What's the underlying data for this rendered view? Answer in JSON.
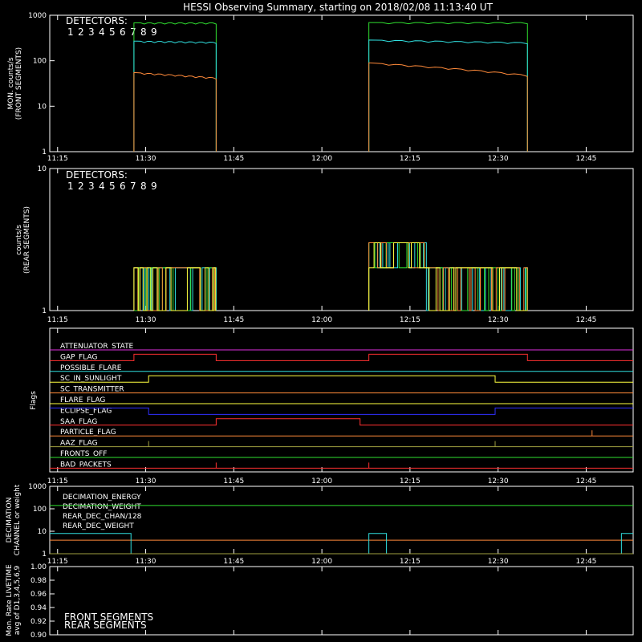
{
  "title": "HESSI Observing Summary, starting on 2018/02/08 11:13:40 UT",
  "x_ticks": [
    "11:15",
    "11:30",
    "11:45",
    "12:00",
    "12:15",
    "12:30",
    "12:45"
  ],
  "detector_colors": [
    "#ff2a2a",
    "#ff5a8a",
    "#ff8a3a",
    "#ffff40",
    "#c8c832",
    "#30e030",
    "#30e0e0",
    "#6a8aff",
    "#3030ff"
  ],
  "chart_data": [
    {
      "type": "line",
      "panel": "front",
      "title": "",
      "detectors_label": "DETECTORS:",
      "detectors": [
        "1",
        "2",
        "3",
        "4",
        "5",
        "6",
        "7",
        "8",
        "9"
      ],
      "ylabel": [
        "MON. counts/s",
        "(FRONT SEGMENTS)"
      ],
      "y_ticks": [
        "1",
        "10",
        "100",
        "1000"
      ],
      "ylim": [
        1,
        1000
      ],
      "yscale": "log",
      "xlim": [
        "11:13:40",
        "12:53:00"
      ],
      "series": [
        {
          "color": "#30e030",
          "values": [
            [
              "11:28:00",
              680
            ],
            [
              "11:42:00",
              680
            ],
            [
              "12:08:00",
              690
            ],
            [
              "12:35:00",
              690
            ]
          ]
        },
        {
          "color": "#30e0e0",
          "values": [
            [
              "11:28:00",
              270
            ],
            [
              "11:42:00",
              255
            ],
            [
              "12:08:00",
              285
            ],
            [
              "12:35:00",
              250
            ]
          ]
        },
        {
          "color": "#ff8a3a",
          "values": [
            [
              "11:28:00",
              55
            ],
            [
              "11:42:00",
              42
            ],
            [
              "12:08:00",
              90
            ],
            [
              "12:35:00",
              48
            ]
          ]
        }
      ]
    },
    {
      "type": "line",
      "panel": "rear",
      "title": "",
      "detectors_label": "DETECTORS:",
      "detectors": [
        "1",
        "2",
        "3",
        "4",
        "5",
        "6",
        "7",
        "8",
        "9"
      ],
      "ylabel": [
        "counts/s",
        "(REAR SEGMENTS)"
      ],
      "y_ticks": [
        "1",
        "10"
      ],
      "ylim": [
        1,
        10
      ],
      "yscale": "log",
      "xlim": [
        "11:13:40",
        "12:53:00"
      ],
      "series_description": "spiky 1-3 counts/s during 11:28-11:42 and 12:08-12:35"
    },
    {
      "type": "line",
      "panel": "flags",
      "ylabel": "Flags",
      "xlim": [
        "11:13:40",
        "12:53:00"
      ],
      "flags": [
        {
          "label": "ATTENUATOR_STATE",
          "color": "#e030e0",
          "segments": [
            [
              "11:13:40",
              "12:53:00",
              0
            ]
          ]
        },
        {
          "label": "GAP_FLAG",
          "color": "#ff3030",
          "segments": [
            [
              "11:13:40",
              "11:28:00",
              0
            ],
            [
              "11:28:00",
              "11:42:00",
              1
            ],
            [
              "11:42:00",
              "12:08:00",
              0
            ],
            [
              "12:08:00",
              "12:35:00",
              1
            ],
            [
              "12:35:00",
              "12:53:00",
              0
            ]
          ]
        },
        {
          "label": "POSSIBLE_FLARE",
          "color": "#30e0e0",
          "segments": [
            [
              "11:13:40",
              "12:53:00",
              0
            ]
          ]
        },
        {
          "label": "SC_IN_SUNLIGHT",
          "color": "#ffff40",
          "segments": [
            [
              "11:13:40",
              "11:30:30",
              0
            ],
            [
              "11:30:30",
              "12:29:30",
              1
            ],
            [
              "12:29:30",
              "12:53:00",
              0
            ]
          ]
        },
        {
          "label": "SC_TRANSMITTER",
          "color": "#ff8a3a",
          "segments": [
            [
              "11:13:40",
              "12:53:00",
              0
            ]
          ]
        },
        {
          "label": "FLARE_FLAG",
          "color": "#ffff40",
          "segments": [
            [
              "11:13:40",
              "12:53:00",
              0
            ]
          ]
        },
        {
          "label": "ECLIPSE_FLAG",
          "color": "#3030ff",
          "segments": [
            [
              "11:13:40",
              "11:30:30",
              1
            ],
            [
              "11:30:30",
              "12:29:30",
              0
            ],
            [
              "12:29:30",
              "12:53:00",
              1
            ]
          ]
        },
        {
          "label": "SAA_FLAG",
          "color": "#ff3030",
          "segments": [
            [
              "11:13:40",
              "11:42:00",
              0
            ],
            [
              "11:42:00",
              "12:06:30",
              1
            ],
            [
              "12:06:30",
              "12:53:00",
              0
            ]
          ]
        },
        {
          "label": "PARTICLE_FLAG",
          "color": "#ff8a3a",
          "segments": [
            [
              "11:13:40",
              "12:53:00",
              0
            ]
          ],
          "spikes": [
            "12:46:00"
          ]
        },
        {
          "label": "AAZ_FLAG",
          "color": "#a0a040",
          "segments": [
            [
              "11:13:40",
              "12:53:00",
              0
            ]
          ],
          "spikes": [
            "11:30:30",
            "12:29:30"
          ]
        },
        {
          "label": "FRONTS_OFF",
          "color": "#30e030",
          "segments": [
            [
              "11:13:40",
              "12:53:00",
              0
            ]
          ]
        },
        {
          "label": "BAD_PACKETS",
          "color": "#ff3030",
          "segments": [
            [
              "11:13:40",
              "12:53:00",
              0
            ]
          ],
          "spikes": [
            "11:42:00",
            "12:08:00"
          ]
        }
      ]
    },
    {
      "type": "line",
      "panel": "decimation",
      "ylabel": [
        "DECIMATION",
        "CHANNEL or weight"
      ],
      "y_ticks": [
        "1",
        "10",
        "100",
        "1000"
      ],
      "ylim": [
        1,
        1000
      ],
      "yscale": "log",
      "xlim": [
        "11:13:40",
        "12:53:00"
      ],
      "legend": [
        {
          "label": "DECIMATION_ENERGY",
          "color": "#30e030"
        },
        {
          "label": "DECIMATION_WEIGHT",
          "color": "#ff8a3a"
        },
        {
          "label": "REAR_DEC_CHAN/128",
          "color": "#30e0e0"
        },
        {
          "label": "REAR_DEC_WEIGHT",
          "color": "#a0a040"
        }
      ],
      "series": [
        {
          "name": "DECIMATION_ENERGY",
          "color": "#30e030",
          "values": [
            [
              "11:13:40",
              140
            ],
            [
              "12:53:00",
              140
            ]
          ]
        },
        {
          "name": "DECIMATION_WEIGHT",
          "color": "#ff8a3a",
          "values": [
            [
              "11:13:40",
              4
            ],
            [
              "12:53:00",
              4
            ]
          ]
        },
        {
          "name": "REAR_DEC_CHAN/128",
          "color": "#30e0e0",
          "steps": [
            [
              "11:13:40",
              "11:27:30",
              8
            ],
            [
              "11:27:30",
              "12:08:00",
              1
            ],
            [
              "12:08:00",
              "12:11:00",
              8
            ],
            [
              "12:11:00",
              "12:51:00",
              1
            ],
            [
              "12:51:00",
              "12:53:00",
              8
            ]
          ]
        },
        {
          "name": "REAR_DEC_WEIGHT",
          "color": "#a0a040",
          "values": [
            [
              "11:13:40",
              1
            ],
            [
              "12:53:00",
              1
            ]
          ]
        }
      ]
    },
    {
      "type": "line",
      "panel": "livetime",
      "ylabel": [
        "Mon. Rate LIVETIME",
        "avg of D1,3,4,5,6,9"
      ],
      "y_ticks": [
        "0.90",
        "0.92",
        "0.94",
        "0.96",
        "0.98",
        "1.00"
      ],
      "ylim": [
        0.9,
        1.0
      ],
      "xlim": [
        "11:13:40",
        "12:53:00"
      ],
      "legend": [
        {
          "label": "FRONT SEGMENTS",
          "color": "#30e030"
        },
        {
          "label": "REAR SEGMENTS",
          "color": "#408040"
        }
      ]
    }
  ]
}
